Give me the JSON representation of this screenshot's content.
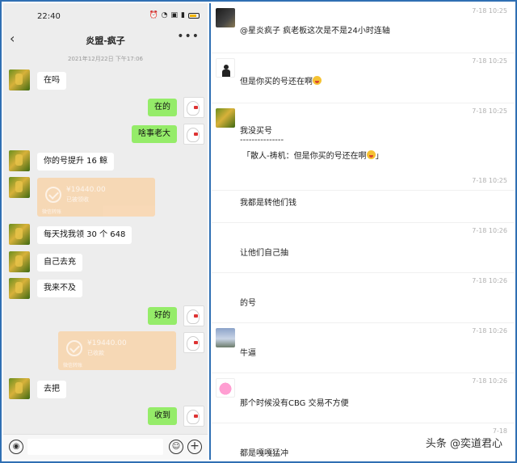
{
  "status_bar": {
    "time": "22:40",
    "icons": [
      "alarm-icon",
      "wifi-icon",
      "sim-icon",
      "signal-icon",
      "battery-icon"
    ]
  },
  "chat": {
    "title": "炎盟-疯子",
    "timestamp": "2021年12月22日 下午17:06",
    "messages": [
      {
        "side": "left",
        "text": "在吗"
      },
      {
        "side": "right",
        "text": "在的"
      },
      {
        "side": "right",
        "text": "啥事老大"
      },
      {
        "side": "left",
        "text": "你的号提升 16 鲸"
      },
      {
        "side": "left",
        "type": "transfer",
        "amount": "¥19440.00",
        "status": "已被领收",
        "foot": "微信转账"
      },
      {
        "side": "left",
        "text": "每天找我领 30 个 648"
      },
      {
        "side": "left",
        "text": "自己去充"
      },
      {
        "side": "left",
        "text": "我来不及"
      },
      {
        "side": "right",
        "text": "好的"
      },
      {
        "side": "right",
        "type": "transfer",
        "amount": "¥19440.00",
        "status": "已收款",
        "foot": "微信转账"
      },
      {
        "side": "left",
        "text": "去把"
      },
      {
        "side": "right",
        "text": "收到"
      }
    ]
  },
  "comments": [
    {
      "time": "7-18 10:25",
      "text": "@星炎疯子 疯老板这次是不是24小时连轴",
      "avatar": "dark-avatar"
    },
    {
      "time": "7-18 10:25",
      "text": "但是你买的号还在啊",
      "emoji": true,
      "avatar": "figure-avatar"
    },
    {
      "time": "7-18 10:25",
      "text": "我没买号",
      "separator": "---------------",
      "quote": "「散人-祷机：但是你买的号还在啊",
      "quote_end": "」",
      "avatar": "green-avatar"
    },
    {
      "time": "7-18 10:25",
      "text": "我都是转他们钱"
    },
    {
      "time": "7-18 10:26",
      "text": "让他们自己抽"
    },
    {
      "time": "7-18 10:26",
      "text": "的号"
    },
    {
      "time": "7-18 10:26",
      "text": "牛逼",
      "avatar": "sky-avatar"
    },
    {
      "time": "7-18 10:26",
      "text": "那个时候没有CBG  交易不方便",
      "avatar": "pink-avatar"
    },
    {
      "time": "7-18",
      "text": "都是嘎嘎猛冲"
    }
  ],
  "watermark": "头条 @奕道君心"
}
